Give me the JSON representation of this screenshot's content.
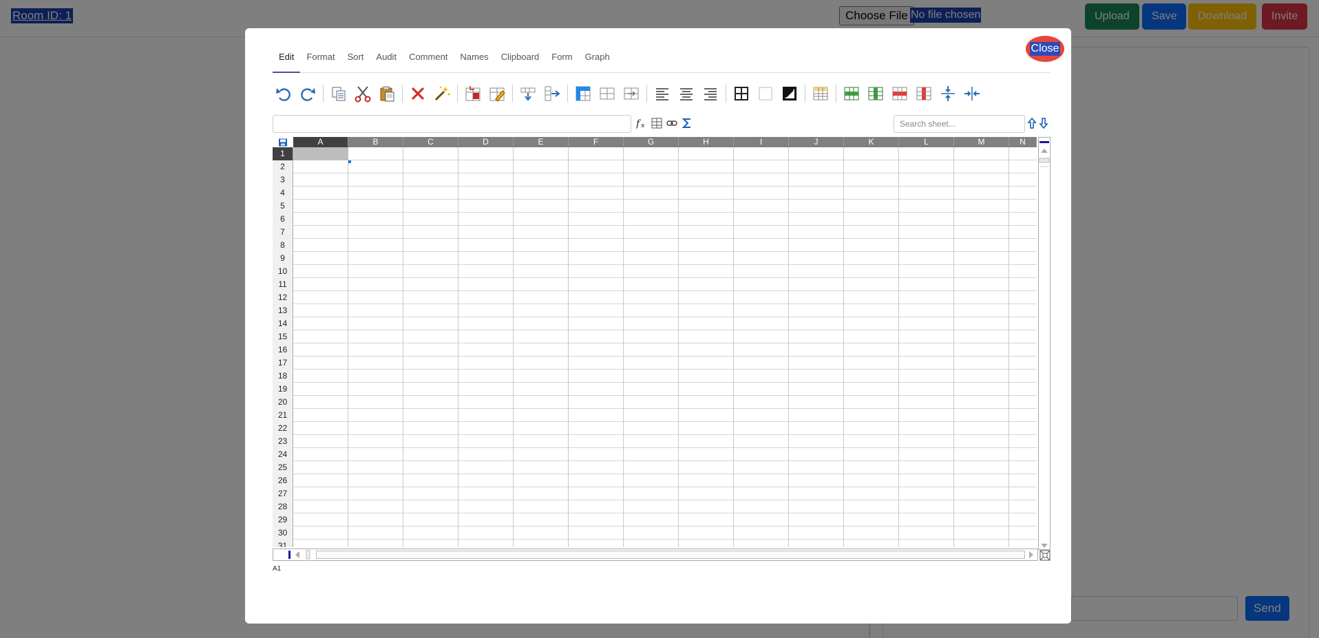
{
  "background": {
    "room_id": "Room ID: 1",
    "file_button": "Choose File",
    "file_status": "No file chosen",
    "buttons": {
      "upload": "Upload",
      "save": "Save",
      "download": "Download",
      "invite": "Invite"
    },
    "send": "Send"
  },
  "modal": {
    "close": "Close",
    "tabs": [
      "Edit",
      "Format",
      "Sort",
      "Audit",
      "Comment",
      "Names",
      "Clipboard",
      "Form",
      "Graph"
    ],
    "active_tab": "Edit",
    "toolbar_icons": [
      "undo-icon",
      "redo-icon",
      "copy-icon",
      "cut-icon",
      "paste-icon",
      "delete-icon",
      "paste-special-icon",
      "lock-cell-icon",
      "unlock-cell-icon",
      "fill-down-icon",
      "fill-right-icon",
      "insert-icon",
      "merge-icon",
      "unmerge-icon",
      "align-left-icon",
      "align-center-icon",
      "align-right-icon",
      "borders-icon",
      "no-border-icon",
      "swap-colors-icon",
      "cell-format-icon",
      "insert-row-icon",
      "insert-column-icon",
      "delete-row-icon",
      "delete-column-icon",
      "pane-split-vertical-icon",
      "pane-split-horizontal-icon"
    ],
    "formula_icons": [
      "function-icon",
      "list-icon",
      "link-icon",
      "sum-icon"
    ],
    "search_placeholder": "Search sheet...",
    "columns": [
      "A",
      "B",
      "C",
      "D",
      "E",
      "F",
      "G",
      "H",
      "I",
      "J",
      "K",
      "L",
      "M",
      "N"
    ],
    "rows": [
      "1",
      "2",
      "3",
      "4",
      "5",
      "6",
      "7",
      "8",
      "9",
      "10",
      "11",
      "12",
      "13",
      "14",
      "15",
      "16",
      "17",
      "18",
      "19",
      "20",
      "21",
      "22",
      "23",
      "24",
      "25",
      "26",
      "27",
      "28",
      "29",
      "30",
      "31"
    ],
    "selected_cell": "A1"
  }
}
